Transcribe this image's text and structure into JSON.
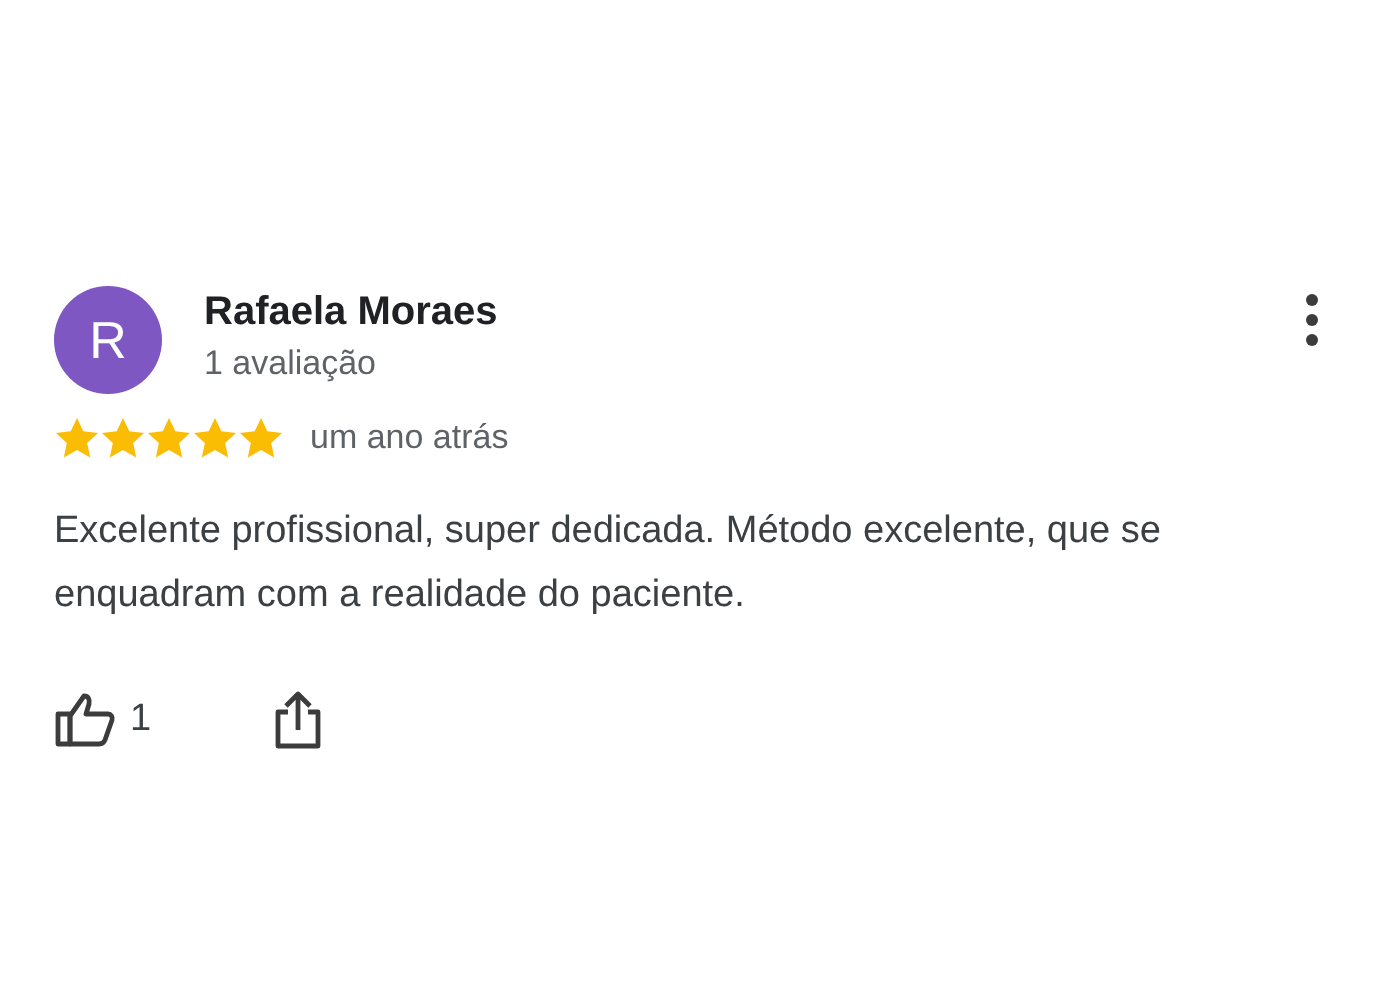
{
  "review": {
    "avatar_letter": "R",
    "name": "Rafaela Moraes",
    "count": "1 avaliação",
    "stars": 5,
    "time": "um ano atrás",
    "text": "Excelente profissional, super dedicada. Método excelente, que se enquadram com a realidade do paciente.",
    "likes": "1"
  }
}
